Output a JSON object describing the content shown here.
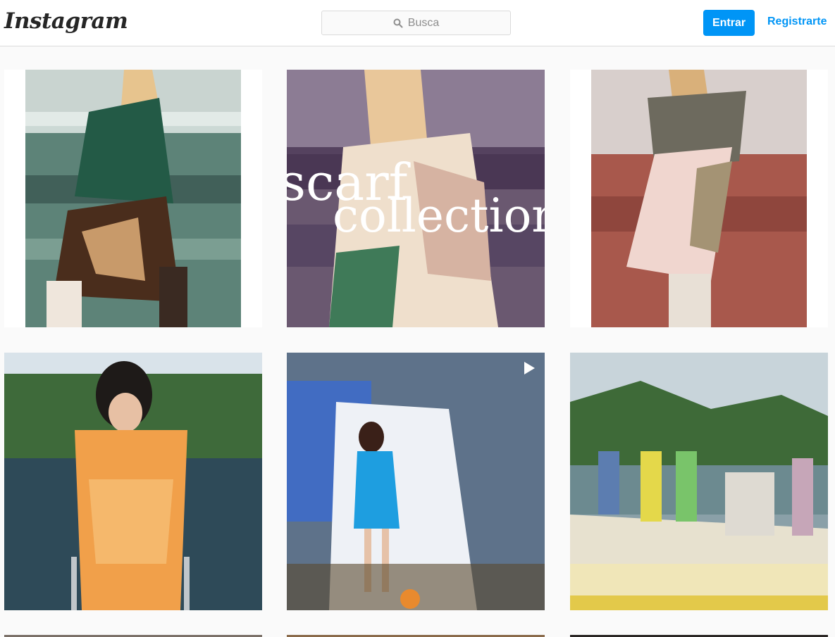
{
  "header": {
    "logo_text": "Instagram",
    "search_placeholder": "Busca",
    "login_label": "Entrar",
    "signup_label": "Registrarte"
  },
  "posts": [
    {
      "id": "post-1",
      "type": "image",
      "overlay_text": ""
    },
    {
      "id": "post-2",
      "type": "image",
      "overlay_line1": "scarf",
      "overlay_line2": "collection"
    },
    {
      "id": "post-3",
      "type": "image",
      "overlay_text": ""
    },
    {
      "id": "post-4",
      "type": "image",
      "overlay_text": ""
    },
    {
      "id": "post-5",
      "type": "video",
      "icon": "play-icon"
    },
    {
      "id": "post-6",
      "type": "image",
      "overlay_text": ""
    }
  ],
  "colors": {
    "accent": "#0095f6",
    "border": "#dbdbdb",
    "background": "#fafafa"
  }
}
